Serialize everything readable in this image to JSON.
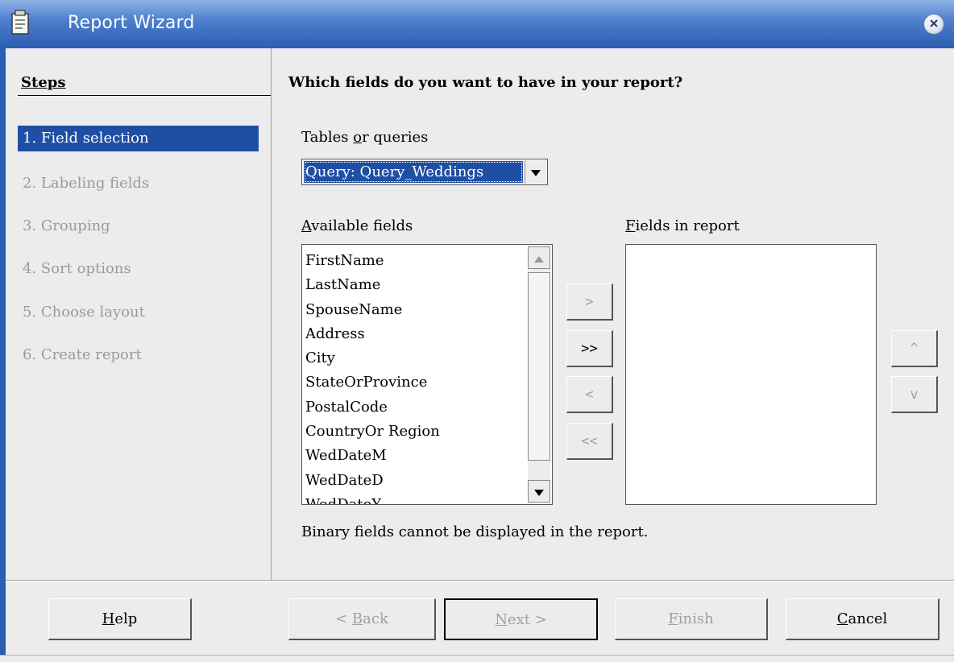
{
  "window": {
    "title": "Report Wizard",
    "icon": "document-icon",
    "close_icon": "close-icon"
  },
  "steps": {
    "title": "Steps",
    "items": [
      {
        "label": "1. Field selection",
        "active": true
      },
      {
        "label": "2. Labeling fields",
        "active": false
      },
      {
        "label": "3. Grouping",
        "active": false
      },
      {
        "label": "4. Sort options",
        "active": false
      },
      {
        "label": "5. Choose layout",
        "active": false
      },
      {
        "label": "6. Create report",
        "active": false
      }
    ]
  },
  "main": {
    "question": "Which fields do you want to have in your report?",
    "tables_label_pre": "Tables ",
    "tables_label_u": "o",
    "tables_label_post": "r queries",
    "tables_value": "Query: Query_Weddings",
    "available_label_u": "A",
    "available_label_rest": "vailable fields",
    "report_label_u": "F",
    "report_label_rest": "ields in report",
    "available_fields": [
      "FirstName",
      "LastName",
      "SpouseName",
      "Address",
      "City",
      "StateOrProvince",
      "PostalCode",
      "CountryOr Region",
      "WedDateM",
      "WedDateD",
      "WedDateY"
    ],
    "report_fields": [],
    "move_buttons": {
      "add": ">",
      "add_all": ">>",
      "remove": "<",
      "remove_all": "<<"
    },
    "order_buttons": {
      "up": "^",
      "down": "v"
    },
    "note": "Binary fields cannot be displayed in the report."
  },
  "footer": {
    "help_u": "H",
    "help_rest": "elp",
    "back_pre": "< ",
    "back_u": "B",
    "back_rest": "ack",
    "next_u": "N",
    "next_rest": "ext >",
    "finish_u": "F",
    "finish_rest": "inish",
    "cancel_u": "C",
    "cancel_rest": "ancel"
  }
}
